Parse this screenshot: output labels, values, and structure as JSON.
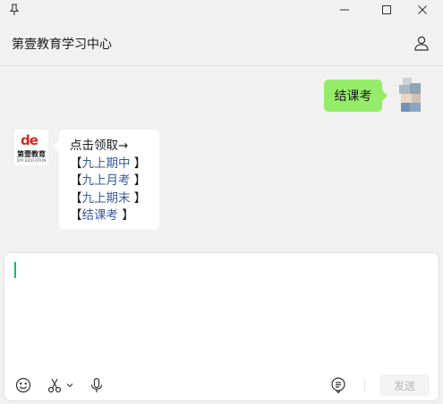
{
  "window": {
    "title": "第壹教育学习中心",
    "icons": [
      "pin-icon",
      "minimize-icon",
      "maximize-icon",
      "close-icon",
      "profile-icon"
    ]
  },
  "messages": [
    {
      "side": "right",
      "text": "结课考"
    },
    {
      "side": "left",
      "intro": "点击领取→",
      "items": [
        {
          "open": "【",
          "label": "九上期中",
          "close": " 】"
        },
        {
          "open": "【",
          "label": "九上月考",
          "close": " 】"
        },
        {
          "open": "【",
          "label": "九上期末",
          "close": " 】"
        },
        {
          "open": "【",
          "label": "结课考",
          "close": " 】"
        }
      ]
    }
  ],
  "bot_avatar": {
    "logo_mark": "de",
    "logo_text": "第壹教育",
    "logo_sub": "DIYI EDUCATION"
  },
  "composer": {
    "send_label": "发送",
    "tools": [
      "emoji-icon",
      "scissors-icon",
      "chevron-down-icon",
      "microphone-icon",
      "chat-history-icon"
    ]
  },
  "colors": {
    "accent": "#07c160",
    "my_bubble": "#95ec69",
    "link": "#3a5b9e",
    "logo_red": "#d9251c"
  }
}
